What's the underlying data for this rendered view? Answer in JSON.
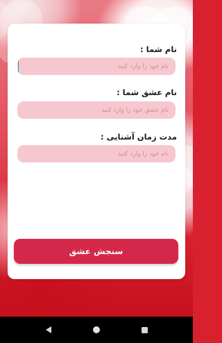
{
  "form": {
    "fields": [
      {
        "label": "نام شما :",
        "placeholder": "نام خود را وارد کنید",
        "value": ""
      },
      {
        "label": "نام عشق شما :",
        "placeholder": "نام عشق خود را وارد کنید",
        "value": ""
      },
      {
        "label": "مدت زمان آشنایی :",
        "placeholder": "نام خود را وارد کنید",
        "value": ""
      }
    ],
    "submit_label": "سنجش عشق"
  },
  "navbar": {
    "icons": [
      "back-triangle-icon",
      "home-circle-icon",
      "recents-square-icon"
    ]
  },
  "colors": {
    "accent": "#d4284a",
    "field_bg": "#f6c7ce",
    "background_red": "#d9202f"
  }
}
